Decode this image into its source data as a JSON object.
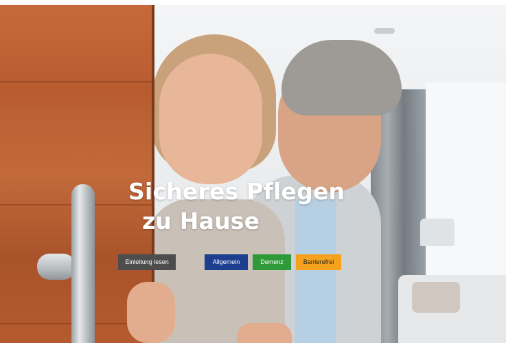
{
  "hero": {
    "headline_line1": "Sicheres Pflegen",
    "headline_line2": "zu Hause",
    "intro_button_label": "Einleitung lesen",
    "categories": [
      {
        "label": "Allgemein",
        "color": "#1d3e8f"
      },
      {
        "label": "Demenz",
        "color": "#2f9a3a"
      },
      {
        "label": "Barrierefrei",
        "color": "#f5a31f"
      }
    ]
  }
}
